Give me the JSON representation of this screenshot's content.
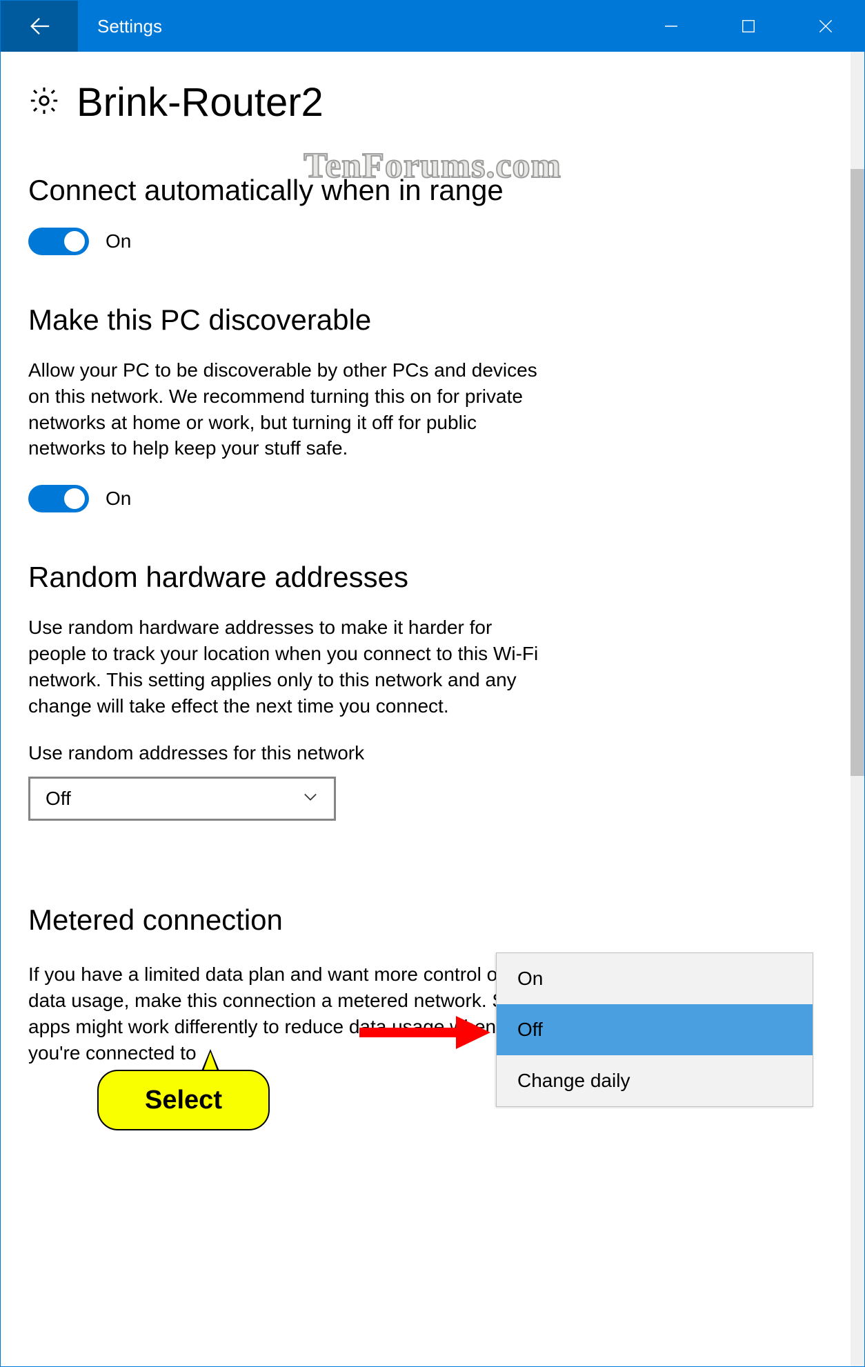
{
  "titlebar": {
    "title": "Settings"
  },
  "page": {
    "heading": "Brink-Router2"
  },
  "watermark": "TenForums.com",
  "sections": {
    "connect_auto": {
      "heading": "Connect automatically when in range",
      "toggle_state": "On"
    },
    "discoverable": {
      "heading": "Make this PC discoverable",
      "desc": "Allow your PC to be discoverable by other PCs and devices on this network. We recommend turning this on for private networks at home or work, but turning it off for public networks to help keep your stuff safe.",
      "toggle_state": "On"
    },
    "random_hw": {
      "heading": "Random hardware addresses",
      "desc": "Use random hardware addresses to make it harder for people to track your location when you connect to this Wi-Fi network. This setting applies only to this network and any change will take effect the next time you connect.",
      "label": "Use random addresses for this network",
      "selected": "Off",
      "menu": {
        "opt1": "On",
        "opt2": "Off",
        "opt3": "Change daily"
      }
    },
    "metered": {
      "heading": "Metered connection",
      "desc": "If you have a limited data plan and want more control over data usage, make this connection a metered network. Some apps might work differently to reduce data usage when you're connected to"
    }
  },
  "annotation": {
    "select_label": "Select"
  }
}
